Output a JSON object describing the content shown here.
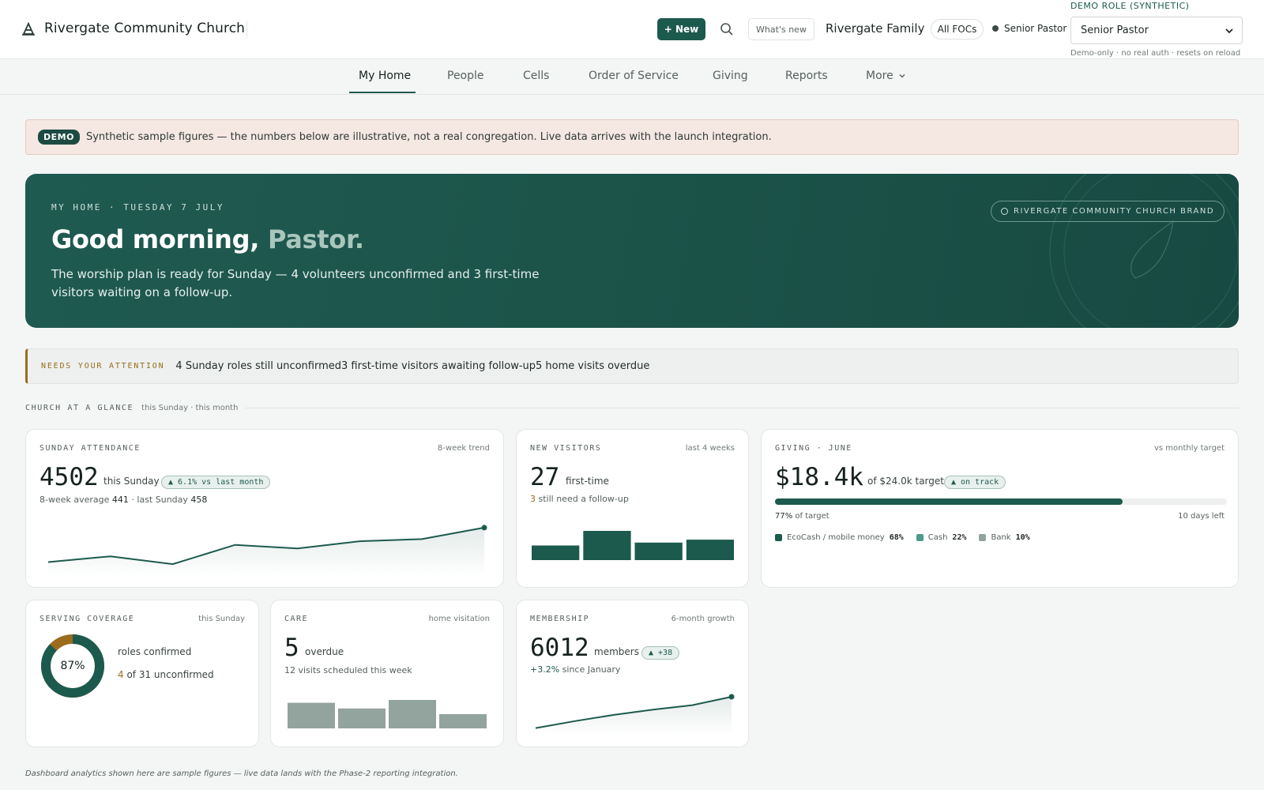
{
  "header": {
    "brand": "Rivergate Community Church",
    "new_label": "+ New",
    "whats_new": "What's new",
    "family": "Rivergate Family",
    "separator": "·",
    "all_focs": "All FOCs",
    "role_indicator": "Senior Pastor",
    "demo_role_label": "DEMO ROLE (SYNTHETIC)",
    "role_select_value": "Senior Pastor",
    "demo_role_note": "Demo-only · no real auth · resets on reload"
  },
  "nav": {
    "items": [
      "My Home",
      "People",
      "Cells",
      "Order of Service",
      "Giving",
      "Reports",
      "More"
    ],
    "active": "My Home"
  },
  "demo_banner": {
    "badge": "DEMO",
    "text": "Synthetic sample figures — the numbers below are illustrative, not a real congregation. Live data arrives with the launch integration."
  },
  "hero": {
    "eyebrow": "MY HOME · TUESDAY 7 JULY",
    "greeting": "Good morning,",
    "name": "Pastor.",
    "body": "The worship plan is ready for Sunday — 4 volunteers unconfirmed and 3 first-time visitors waiting on a follow-up.",
    "brand_chip": "RIVERGATE COMMUNITY CHURCH BRAND"
  },
  "attention": {
    "label": "NEEDS YOUR ATTENTION",
    "items_text": "4 Sunday roles still unconfirmed3 first-time visitors awaiting follow-up5 home visits overdue"
  },
  "glance": {
    "title": "CHURCH AT A GLANCE",
    "subtitle": "this Sunday · this month"
  },
  "cards": {
    "attendance": {
      "label": "SUNDAY ATTENDANCE",
      "tag": "8-week trend",
      "value": "4502",
      "unit": "this Sunday",
      "pill": "▲ 6.1% vs last month",
      "avg_label": "8-week average",
      "avg_value": "441",
      "last_label": "· last Sunday",
      "last_value": "458"
    },
    "visitors": {
      "label": "NEW VISITORS",
      "tag": "last 4 weeks",
      "value": "27",
      "unit": "first-time",
      "followup_count": "3",
      "followup_text": "still need a follow-up"
    },
    "giving": {
      "label": "GIVING · JUNE",
      "tag": "vs monthly target",
      "value": "$18.4k",
      "unit": "of $24.0k target",
      "pill": "▲ on track",
      "pct_label": "77%",
      "pct_suffix": "of target",
      "days_left": "10 days left",
      "progress_fraction": 0.77,
      "legend": [
        {
          "name": "EcoCash / mobile money",
          "pct": "68%",
          "color": "#1d5a4e"
        },
        {
          "name": "Cash",
          "pct": "22%",
          "color": "#4f9a8a"
        },
        {
          "name": "Bank",
          "pct": "10%",
          "color": "#93a39d"
        }
      ]
    },
    "serving": {
      "label": "SERVING COVERAGE",
      "tag": "this Sunday",
      "center": "87%",
      "coverage_fraction": 0.87,
      "confirmed_text": "roles confirmed",
      "unconfirmed_count": "4",
      "unconfirmed_text": "of 31 unconfirmed"
    },
    "care": {
      "label": "CARE",
      "tag": "home visitation",
      "value": "5",
      "unit": "overdue",
      "scheduled": "12 visits scheduled this week"
    },
    "membership": {
      "label": "MEMBERSHIP",
      "tag": "6-month growth",
      "value": "6012",
      "unit": "members",
      "pill": "▲ +38",
      "growth_value": "+3.2%",
      "growth_text": "since January"
    }
  },
  "footer_note": "Dashboard analytics shown here are sample figures — live data lands with the Phase-2 reporting integration.",
  "colors": {
    "brand": "#1d5a4e",
    "hero": "#1c544a",
    "amber": "#9a6c1c",
    "banner": "#f5e7e2",
    "muted_bar": "#93a39d"
  },
  "chart_data": [
    {
      "type": "line",
      "name": "sunday-attendance-trend",
      "x": [
        1,
        2,
        3,
        4,
        5,
        6,
        7,
        8
      ],
      "values": [
        0.22,
        0.33,
        0.18,
        0.55,
        0.48,
        0.62,
        0.66,
        0.88
      ],
      "ylim": [
        0,
        1
      ]
    },
    {
      "type": "bar",
      "name": "new-visitors",
      "categories": [
        "W1",
        "W2",
        "W3",
        "W4"
      ],
      "values": [
        5,
        10,
        6,
        7
      ],
      "ylim": [
        0,
        10
      ]
    },
    {
      "type": "bar",
      "name": "care-visits",
      "categories": [
        "W1",
        "W2",
        "W3",
        "W4"
      ],
      "values": [
        9,
        7,
        10,
        5
      ],
      "ylim": [
        0,
        10
      ]
    },
    {
      "type": "line",
      "name": "membership-growth",
      "x": [
        1,
        2,
        3,
        4,
        5,
        6
      ],
      "values": [
        0.1,
        0.3,
        0.48,
        0.63,
        0.76,
        1.0
      ],
      "ylim": [
        0,
        1
      ]
    }
  ]
}
